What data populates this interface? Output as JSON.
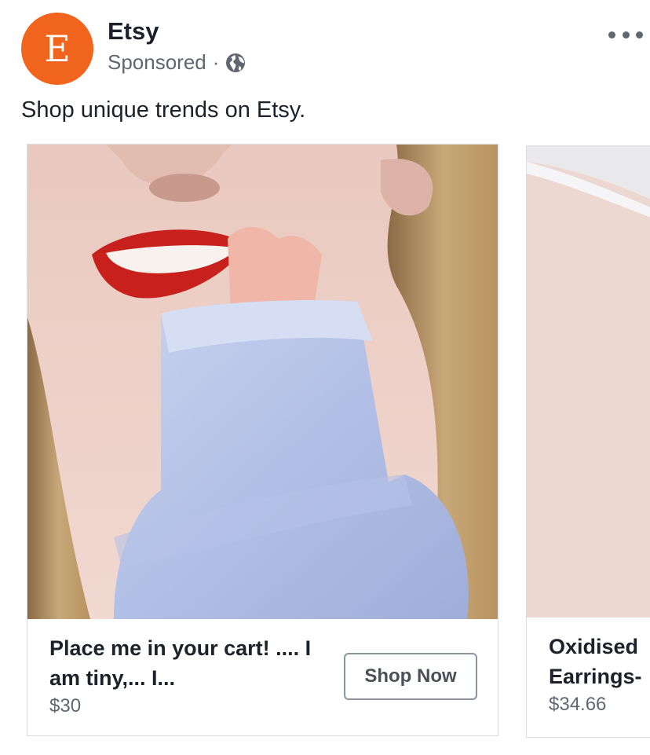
{
  "header": {
    "avatar_letter": "E",
    "page_name": "Etsy",
    "sponsored_label": "Sponsored",
    "separator": "·",
    "icons": {
      "audience": "globe-icon",
      "more": "more-options-icon"
    }
  },
  "post": {
    "text": "Shop unique trends on Etsy."
  },
  "carousel": [
    {
      "title": "Place me in your cart! .... I am tiny,... I...",
      "price": "$30",
      "cta": "Shop Now"
    },
    {
      "title": "Oxidised\nEarrings-",
      "price": "$34.66"
    }
  ],
  "colors": {
    "brand": "#F1641E",
    "text": "#1d2129",
    "secondary_text": "#616770",
    "border": "#dadde1"
  }
}
